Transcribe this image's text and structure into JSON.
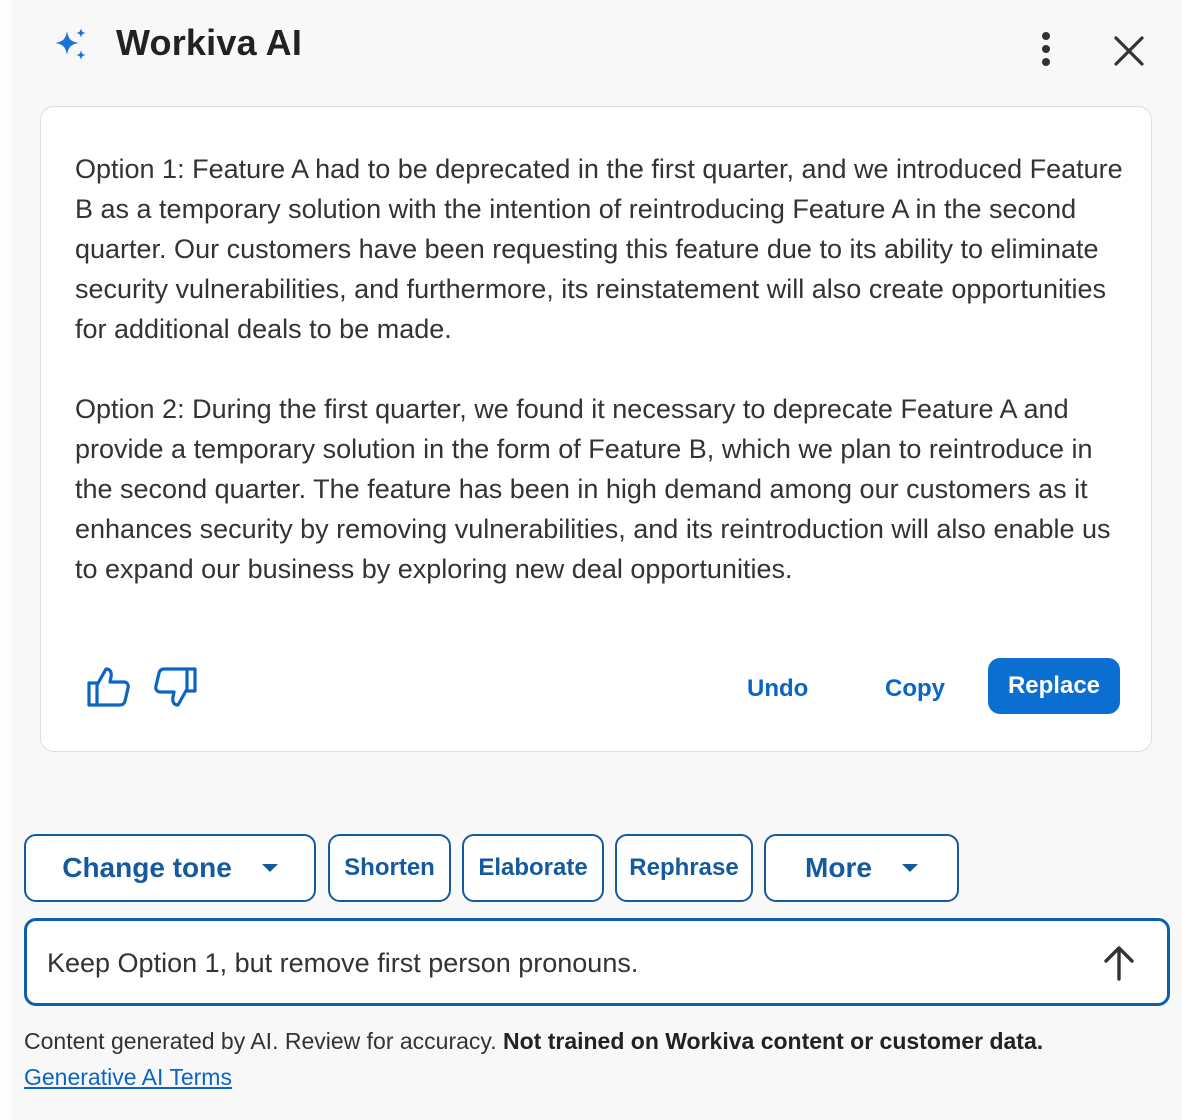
{
  "header": {
    "title": "Workiva AI",
    "icons": {
      "brand": "sparkle-icon",
      "menu": "kebab-menu-icon",
      "close": "close-icon"
    }
  },
  "response": {
    "paragraphs": [
      "Option 1: Feature A had to be deprecated in the first quarter, and we introduced Feature B as a temporary solution with the intention of reintroducing Feature A in the second quarter. Our customers have been requesting this feature due to its ability to eliminate security vulnerabilities, and furthermore, its reinstatement will also create opportunities for additional deals to be made.",
      "Option 2: During the first quarter, we found it necessary to deprecate Feature A and provide a temporary solution in the form of Feature B, which we plan to reintroduce in the second quarter. The feature has been in high demand among our customers as it enhances security by removing vulnerabilities, and its reintroduction will also enable us to expand our business by exploring new deal opportunities."
    ],
    "feedback_icons": [
      "thumbs-up-icon",
      "thumbs-down-icon"
    ],
    "actions": {
      "undo": "Undo",
      "copy": "Copy",
      "replace": "Replace"
    }
  },
  "chips": {
    "change_tone": "Change tone",
    "shorten": "Shorten",
    "elaborate": "Elaborate",
    "rephrase": "Rephrase",
    "more": "More"
  },
  "prompt": {
    "value": "Keep Option 1, but remove first person pronouns.",
    "send_icon": "arrow-up-icon"
  },
  "footer": {
    "disclaimer_plain": "Content generated by AI. Review for accuracy. ",
    "disclaimer_bold": "Not trained on Workiva content or customer data.",
    "terms_link": "Generative AI Terms"
  },
  "colors": {
    "accent": "#0b6fd2",
    "chip_border": "#155a9e",
    "sparkle": "#1a73d9",
    "background": "#f8f8f8"
  }
}
